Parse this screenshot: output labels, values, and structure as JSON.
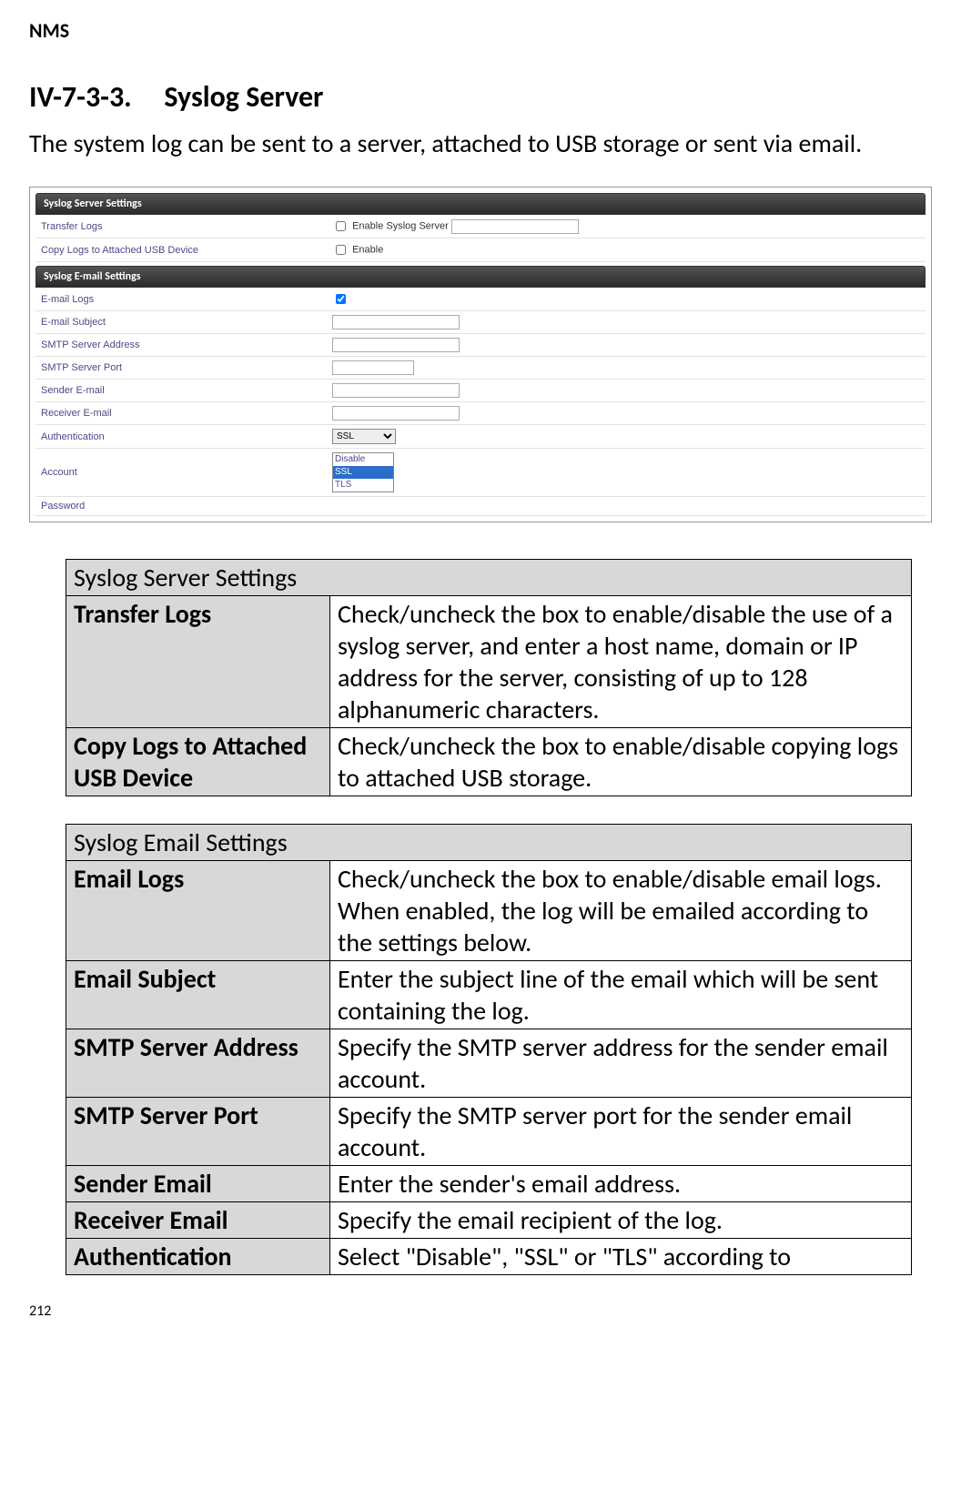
{
  "header": "NMS",
  "section_number": "IV-7-3-3.",
  "section_title": "Syslog Server",
  "intro": "The system log can be sent to a server, attached to USB storage or sent via email.",
  "screenshot": {
    "panel1_title": "Syslog Server Settings",
    "panel2_title": "Syslog E-mail Settings",
    "rows1": [
      {
        "label": "Transfer Logs",
        "control_text": "Enable Syslog Server"
      },
      {
        "label": "Copy Logs to Attached USB Device",
        "control_text": "Enable"
      }
    ],
    "rows2": [
      {
        "label": "E-mail Logs"
      },
      {
        "label": "E-mail Subject"
      },
      {
        "label": "SMTP Server Address"
      },
      {
        "label": "SMTP Server Port"
      },
      {
        "label": "Sender E-mail"
      },
      {
        "label": "Receiver E-mail"
      },
      {
        "label": "Authentication",
        "select_value": "SSL"
      },
      {
        "label": "Account"
      },
      {
        "label": "Password"
      }
    ],
    "dropdown_options": [
      "Disable",
      "SSL",
      "TLS"
    ]
  },
  "tables": [
    {
      "title": "Syslog Server Settings",
      "rows": [
        {
          "name": "Transfer Logs",
          "desc": "Check/uncheck the box to enable/disable the use of a syslog server, and enter a host name, domain or IP address for the server, consisting of up to 128 alphanumeric characters."
        },
        {
          "name": "Copy Logs to Attached USB Device",
          "desc": "Check/uncheck the box to enable/disable copying logs to attached USB storage."
        }
      ]
    },
    {
      "title": "Syslog Email Settings",
      "rows": [
        {
          "name": "Email Logs",
          "desc": "Check/uncheck the box to enable/disable email logs. When enabled, the log will be emailed according to the settings below."
        },
        {
          "name": "Email Subject",
          "desc": "Enter the subject line of the email which will be sent containing the log."
        },
        {
          "name": "SMTP Server Address",
          "desc": "Specify the SMTP server address for the sender email account."
        },
        {
          "name": "SMTP Server Port",
          "desc": "Specify the SMTP server port for the sender email account."
        },
        {
          "name": "Sender Email",
          "desc": "Enter the sender's email address."
        },
        {
          "name": "Receiver Email",
          "desc": "Specify the email recipient of the log."
        },
        {
          "name": "Authentication",
          "desc": "Select \"Disable\", \"SSL\" or \"TLS\" according to"
        }
      ]
    }
  ],
  "page_number": "212"
}
